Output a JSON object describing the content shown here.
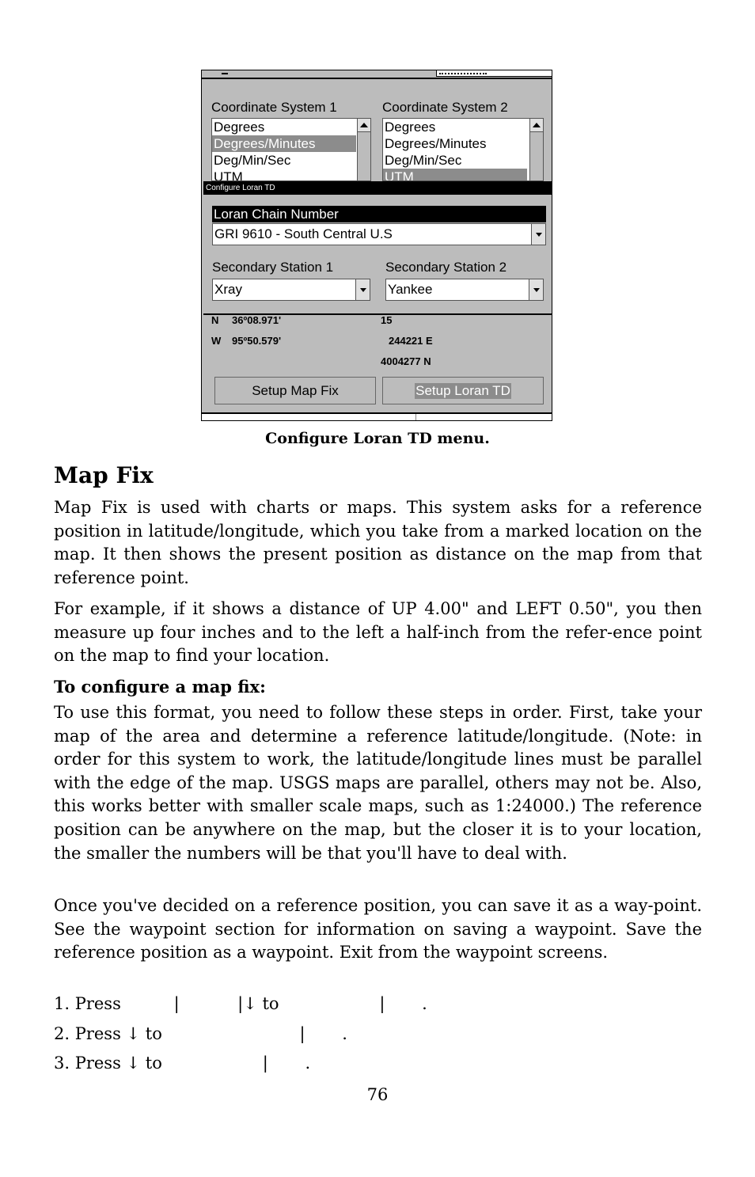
{
  "screenshot": {
    "coord_system_1": {
      "label": "Coordinate System 1",
      "items": [
        "Degrees",
        "Degrees/Minutes",
        "Deg/Min/Sec",
        "UTM"
      ],
      "selected": "Degrees/Minutes"
    },
    "coord_system_2": {
      "label": "Coordinate System 2",
      "items": [
        "Degrees",
        "Degrees/Minutes",
        "Deg/Min/Sec",
        "UTM"
      ],
      "selected": "UTM"
    },
    "dialog": {
      "title": "Configure Loran TD",
      "chain_label": "Loran Chain Number",
      "chain_value": "GRI 9610 - South Central U.S",
      "secondary_1_label": "Secondary Station 1",
      "secondary_1_value": "Xray",
      "secondary_2_label": "Secondary Station 2",
      "secondary_2_value": "Yankee"
    },
    "readout": {
      "lat_hemi": "N",
      "lat": "36º08.971'",
      "lon_hemi": "W",
      "lon": "95º50.579'",
      "utm_zone": "15",
      "utm_east": "244221  E",
      "utm_north": "4004277  N"
    },
    "buttons": {
      "setup_map_fix": "Setup Map Fix",
      "setup_loran_td": "Setup Loran TD"
    }
  },
  "document": {
    "caption": "Configure Loran TD menu.",
    "heading": "Map Fix",
    "para1": "Map Fix is used with charts or maps. This system asks for a reference position in latitude/longitude, which you take from a marked location on the map. It then shows the present position as distance on the map from that reference point.",
    "para2": "For example, if it shows a distance of UP 4.00\" and LEFT 0.50\", you then measure up four inches and to the left a half-inch from the refer-ence point on the map to find your location.",
    "subheading": "To configure a map fix:",
    "para3": "To use this format, you need to follow these steps in order. First, take your map of the area and determine a reference latitude/longitude. (Note: in order for this system to work, the latitude/longitude lines must be parallel with the edge of the map. USGS maps are parallel, others may not be. Also, this works better with smaller scale maps, such as 1:24000.) The reference position can be anywhere on the map, but the closer it is to your location, the smaller the numbers will be that you'll have to deal with.",
    "para4": "Once you've decided on a reference position, you can save it as a way-point. See the waypoint section for information on saving a waypoint. Save the reference position as a waypoint. Exit from the waypoint screens.",
    "steps": [
      "1. Press          |           |↓ to                   |       .",
      "2. Press ↓ to                          |       .",
      "3. Press ↓ to                   |       ."
    ],
    "page_number": "76"
  }
}
